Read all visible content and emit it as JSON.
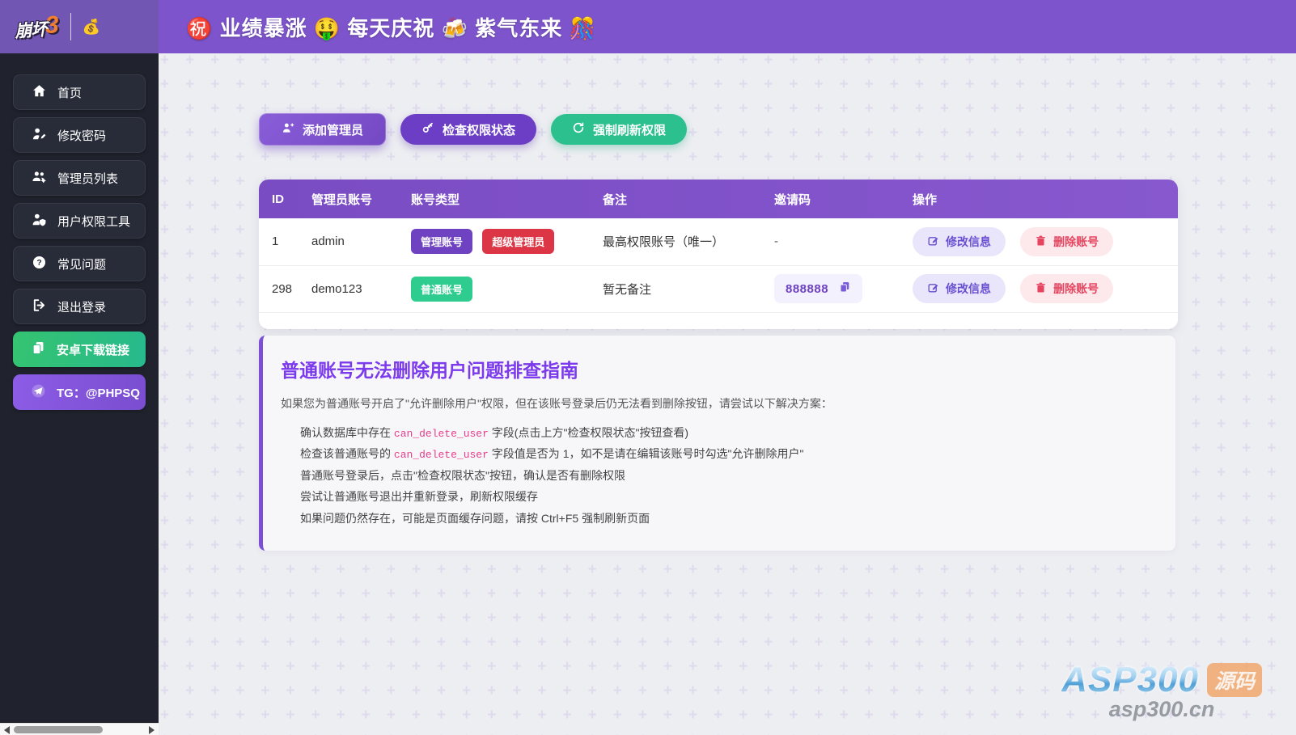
{
  "colors": {
    "header_purple": "#7d54cb",
    "sidebar_bg": "#20232e",
    "table_header_purple": "#7a4cc4",
    "badge_admin": "#6f42c1",
    "badge_super": "#dc3545",
    "badge_normal": "#2ecc8f",
    "accent_green": "#2bc08d",
    "guide_accent": "#7c3aed",
    "code_pink": "#e83e8c"
  },
  "header": {
    "logo_text_main": "崩坏",
    "logo_text_number": "3",
    "money_emoji": "💰",
    "title": "㊗️ 业绩暴涨 🤑 每天庆祝 🍻 紫气东来 🎊"
  },
  "sidebar": {
    "items": [
      {
        "label": "首页",
        "icon": "home-icon"
      },
      {
        "label": "修改密码",
        "icon": "user-pen-icon"
      },
      {
        "label": "管理员列表",
        "icon": "users-gear-icon"
      },
      {
        "label": "用户权限工具",
        "icon": "user-shield-icon"
      },
      {
        "label": "常见问题",
        "icon": "circle-question-icon"
      },
      {
        "label": "退出登录",
        "icon": "logout-icon"
      }
    ],
    "android_link_label": "安卓下载链接",
    "telegram_label": "TG：@PHPSQ"
  },
  "toolbar": {
    "add_admin_label": "添加管理员",
    "check_permission_label": "检查权限状态",
    "force_refresh_label": "强制刷新权限"
  },
  "table": {
    "columns": [
      "ID",
      "管理员账号",
      "账号类型",
      "备注",
      "邀请码",
      "操作"
    ],
    "rows": [
      {
        "id": "1",
        "account": "admin",
        "badges": [
          {
            "text": "管理账号",
            "color": "#6f42c1"
          },
          {
            "text": "超级管理员",
            "color": "#dc3545"
          }
        ],
        "note": "最高权限账号（唯一）",
        "invite": "-",
        "edit_label": "修改信息",
        "delete_label": "删除账号"
      },
      {
        "id": "298",
        "account": "demo123",
        "badges": [
          {
            "text": "普通账号",
            "color": "#2ecc8f"
          }
        ],
        "note": "暂无备注",
        "invite": "888888",
        "edit_label": "修改信息",
        "delete_label": "删除账号"
      }
    ]
  },
  "guide": {
    "title": "普通账号无法删除用户问题排查指南",
    "intro": "如果您为普通账号开启了\"允许删除用户\"权限，但在该账号登录后仍无法看到删除按钮，请尝试以下解决方案：",
    "steps": [
      {
        "pre": "确认数据库中存在 ",
        "code": "can_delete_user",
        "post": " 字段(点击上方\"检查权限状态\"按钮查看)"
      },
      {
        "pre": "检查该普通账号的 ",
        "code": "can_delete_user",
        "post": " 字段值是否为 1，如不是请在编辑该账号时勾选\"允许删除用户\""
      },
      {
        "pre": "普通账号登录后，点击\"检查权限状态\"按钮，确认是否有删除权限",
        "code": "",
        "post": ""
      },
      {
        "pre": "尝试让普通账号退出并重新登录，刷新权限缓存",
        "code": "",
        "post": ""
      },
      {
        "pre": "如果问题仍然存在，可能是页面缓存问题，请按 Ctrl+F5 强制刷新页面",
        "code": "",
        "post": ""
      }
    ]
  },
  "watermark": {
    "brand": "ASP300",
    "badge": "源码",
    "domain": "asp300.cn"
  }
}
